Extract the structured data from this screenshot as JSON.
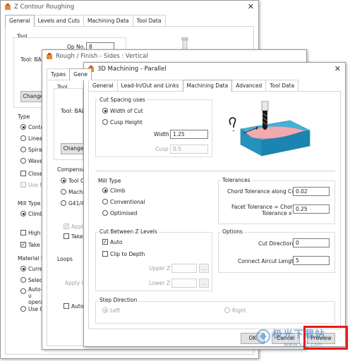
{
  "dialog1": {
    "title": "Z Contour Roughing",
    "tabs": [
      "General",
      "Levels and Cuts",
      "Machining Data",
      "Tool Data"
    ],
    "tool_label": "Tool",
    "op_no_label": "Op No.",
    "op_no_value": "8",
    "tool_name": "Tool: BAL",
    "change_btn": "Change",
    "type_label": "Type",
    "type_options": [
      "Contour",
      "Linear",
      "Spiral",
      "Wavefo"
    ],
    "close_label": "Close C",
    "use_m_label": "Use M",
    "mill_type_label": "Mill Type",
    "climb_label": "Climb",
    "high_s_label": "High S",
    "take_a_label": "Take A",
    "material_label": "Material Se",
    "material_options": [
      "Curren",
      "Select",
      "Auto-u operat",
      "Use G"
    ]
  },
  "dialog2": {
    "title": "Rough / Finish - Sides : Vertical",
    "tabs": [
      "Types",
      "Gene"
    ],
    "tool_label": "Tool",
    "tool_name": "Tool: BAL",
    "change_btn": "Change",
    "compensation_label": "Compensatio",
    "comp_options": [
      "Tool Ce",
      "Machin",
      "G41/42"
    ],
    "apply_label": "Apply",
    "take_label": "Take",
    "loops_label": "Loops",
    "apply_lo_label": "Apply lo",
    "auto_label": "Auto"
  },
  "dialog3": {
    "title": "3D Machining - Parallel",
    "tabs": [
      "General",
      "Lead-In/Out and Links",
      "Machining Data",
      "Advanced",
      "Tool Data"
    ],
    "active_tab": "Machining Data",
    "cut_spacing": {
      "label": "Cut Spacing uses",
      "width_of_cut": "Width of Cut",
      "cusp_height": "Cusp Height",
      "width_label": "Width",
      "width_value": "1.25",
      "cusp_label": "Cusp",
      "cusp_value": "0.5"
    },
    "mill_type": {
      "label": "Mill Type",
      "options": [
        "Climb",
        "Conventional",
        "Optimised"
      ]
    },
    "tolerances": {
      "label": "Tolerances",
      "chord_label": "Chord Tolerance along Cut",
      "chord_value": "0.02",
      "facet_label_1": "Facet Tolerance = Chord",
      "facet_label_2": "Tolerance x",
      "facet_value": "0.25"
    },
    "cut_between": {
      "label": "Cut Between Z Levels",
      "auto_label": "Auto",
      "clip_label": "Clip to Depth",
      "upper_label": "Upper Z",
      "lower_label": "Lower Z",
      "browse": "..."
    },
    "options": {
      "label": "Options",
      "cut_dir_label": "Cut Direction",
      "cut_dir_value": "0",
      "aircut_label": "Connect Aircut Length",
      "aircut_value": "5"
    },
    "step_direction": {
      "label": "Step Direction",
      "left": "Left",
      "right": "Right"
    },
    "buttons": {
      "ok": "OK",
      "cancel": "Cancel",
      "preview": "Preview"
    }
  },
  "watermark": {
    "text_cn": "极光下载站",
    "text_url": "www.xz7.com"
  },
  "colors": {
    "highlight_box": "#e8191a",
    "part_blue": "#2aa9d4",
    "part_pink": "#f2b0b4"
  }
}
